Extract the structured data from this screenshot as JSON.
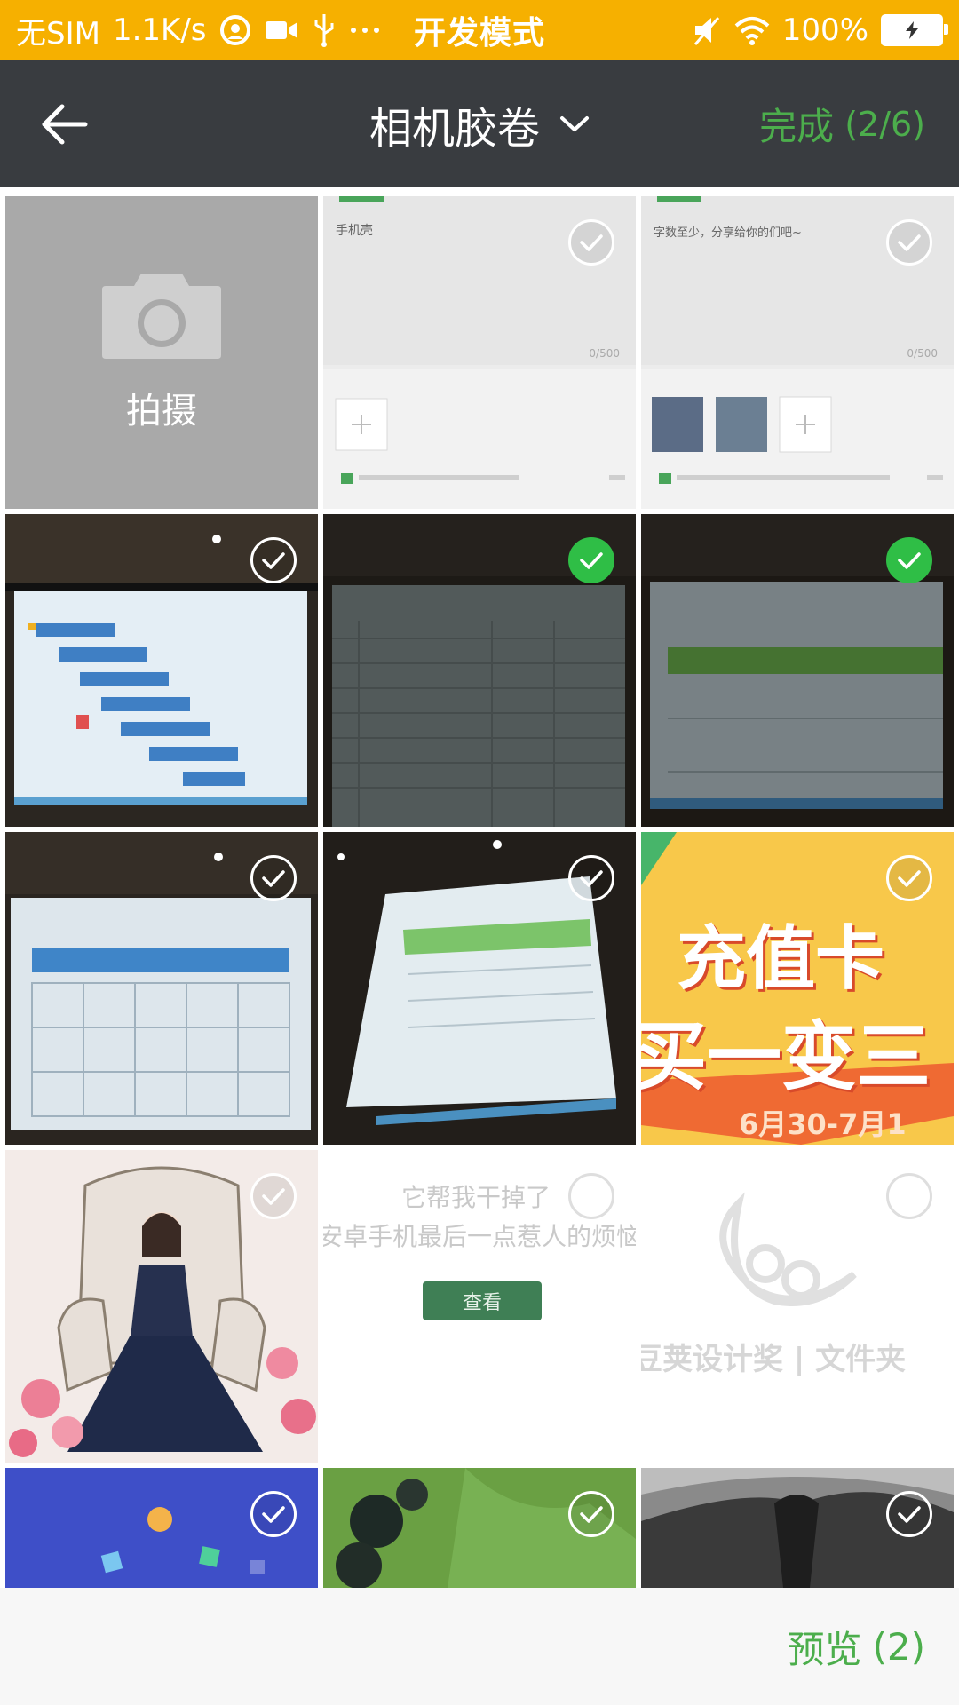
{
  "status_bar": {
    "carrier": "无SIM",
    "speed": "1.1K/s",
    "center_text": "开发模式",
    "battery": "100%",
    "icons": [
      "notification-icon",
      "video-icon",
      "usb-icon",
      "more-dots-icon",
      "mute-icon",
      "wifi-icon",
      "battery-icon"
    ]
  },
  "header": {
    "album_title": "相机胶卷",
    "done_label": "完成",
    "done_count": "(2/6)"
  },
  "grid": {
    "camera_label": "拍摄",
    "tiles": [
      {
        "kind": "screenshot-form",
        "hint": "手机壳",
        "counter": "0/500",
        "checked": false
      },
      {
        "kind": "screenshot-form",
        "hint": "字数至少，分享给你的们吧~",
        "counter": "0/500",
        "checked": false
      },
      {
        "kind": "photo-projector",
        "checked": false
      },
      {
        "kind": "photo-projector",
        "checked": true
      },
      {
        "kind": "photo-projector",
        "checked": true
      },
      {
        "kind": "photo-projector",
        "checked": false
      },
      {
        "kind": "photo-projector",
        "checked": false
      },
      {
        "kind": "banner-recharge",
        "line1": "充值卡",
        "line2": "买一变三",
        "date": "6月30-7月1",
        "checked": false
      },
      {
        "kind": "illustration-queen",
        "checked": false
      },
      {
        "kind": "ad-white",
        "line1": "它帮我干掉了",
        "line2": "安卓手机最后一点惹人的烦恼",
        "button": "查看",
        "checked": false
      },
      {
        "kind": "ad-logo",
        "caption": "豆荚设计奖 | 文件夹",
        "checked": false
      },
      {
        "kind": "blue-wallpaper",
        "checked": false
      },
      {
        "kind": "berries",
        "checked": false
      },
      {
        "kind": "bw-bird",
        "checked": false
      }
    ]
  },
  "footer": {
    "preview_label": "预览",
    "preview_count": "(2)"
  },
  "colors": {
    "status_bar": "#f6b000",
    "title_bar": "#393c40",
    "accent_green": "#4cae4c",
    "check_green": "#2fbe46",
    "camera_tile": "#a9a9a9"
  }
}
